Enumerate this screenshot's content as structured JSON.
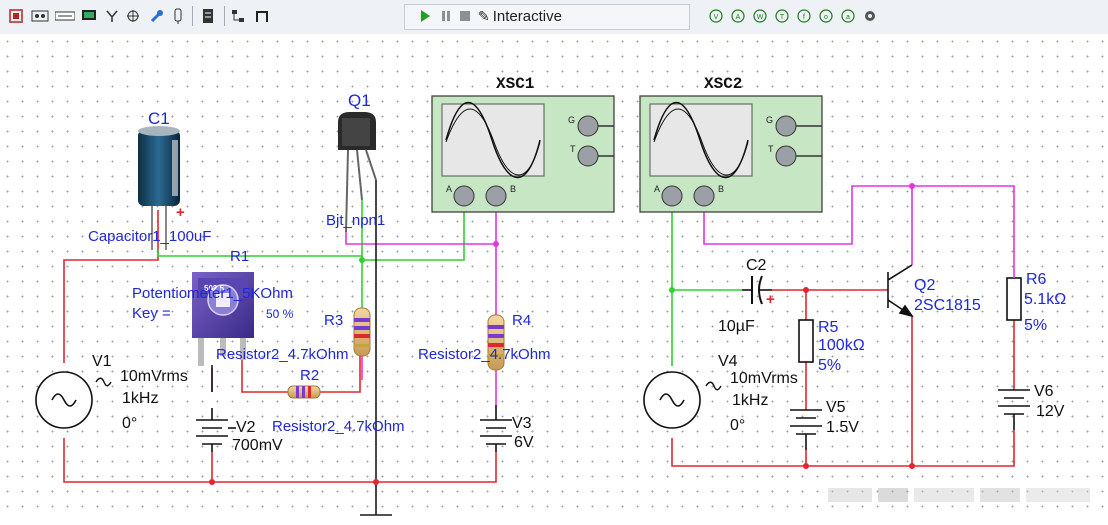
{
  "toolbar": {
    "interactive_label": "Interactive"
  },
  "colors": {
    "wire_red": "#e1262e",
    "wire_green": "#2fd12f",
    "wire_magenta": "#e334e3",
    "wire_dark": "#1a1a1a",
    "label_blue": "#1f27d8",
    "scope_body": "#c6e6c4"
  },
  "schematic": {
    "c1": {
      "ref": "C1",
      "model": "Capacitor1_100uF",
      "polarity": "+"
    },
    "q1": {
      "ref": "Q1",
      "model": "Bjt_npn1"
    },
    "xsc1": {
      "ref": "XSC1",
      "g": "G",
      "t": "T",
      "a": "A",
      "b": "B"
    },
    "xsc2": {
      "ref": "XSC2",
      "g": "G",
      "t": "T",
      "a": "A",
      "b": "B"
    },
    "r1": {
      "ref": "R1",
      "model": "Potentiometer1_5KOhm",
      "key": "Key = ",
      "percent": "50 %",
      "body_text": "502 5"
    },
    "r2": {
      "ref": "R2",
      "model": "Resistor2_4.7kOhm"
    },
    "r3": {
      "ref": "R3",
      "model": "Resistor2_4.7kOhm"
    },
    "r4": {
      "ref": "R4",
      "model": "Resistor2_4.7kOhm"
    },
    "v1": {
      "ref": "V1",
      "amp": "10mVrms",
      "freq": "1kHz",
      "phase": "0°"
    },
    "v2": {
      "ref": "V2",
      "value": "700mV"
    },
    "v3": {
      "ref": "V3",
      "value": "6V"
    },
    "c2": {
      "ref": "C2",
      "value": "10µF",
      "polarity": "+"
    },
    "r5": {
      "ref": "R5",
      "value": "100kΩ",
      "tol": "5%"
    },
    "q2": {
      "ref": "Q2",
      "model": "2SC1815"
    },
    "r6": {
      "ref": "R6",
      "value": "5.1kΩ",
      "tol": "5%"
    },
    "v4": {
      "ref": "V4",
      "amp": "10mVrms",
      "freq": "1kHz",
      "phase": "0°"
    },
    "v5": {
      "ref": "V5",
      "value": "1.5V"
    },
    "v6": {
      "ref": "V6",
      "value": "12V"
    }
  }
}
